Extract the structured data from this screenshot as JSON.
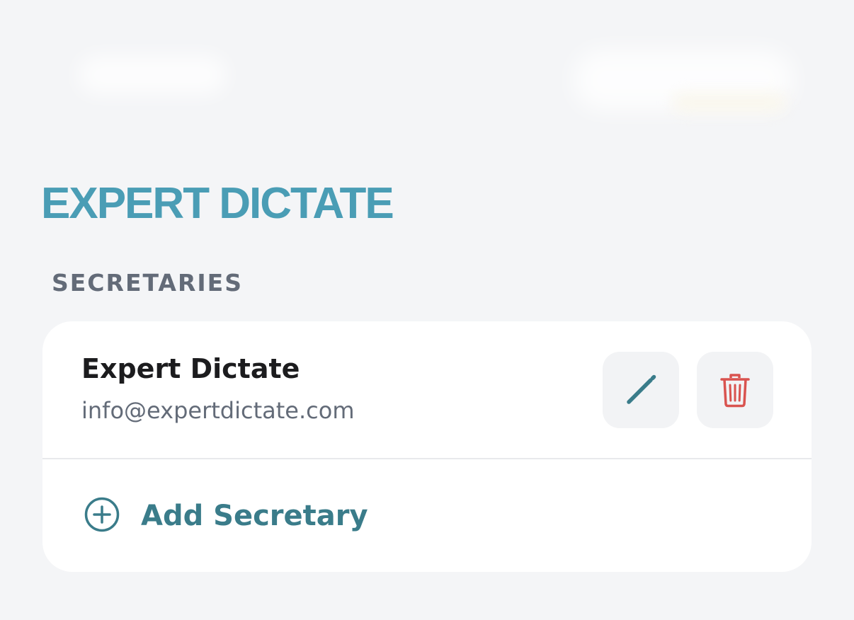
{
  "brand": {
    "logo_text": "EXPERT DICTATE",
    "color": "#4a9db5"
  },
  "section": {
    "header": "SECRETARIES"
  },
  "secretaries": [
    {
      "name": "Expert Dictate",
      "email": "info@expertdictate.com",
      "actions": {
        "edit_icon": "pencil-icon",
        "delete_icon": "trash-icon"
      }
    }
  ],
  "add_action": {
    "label": "Add Secretary",
    "icon": "plus-circle-icon"
  },
  "colors": {
    "background": "#f4f5f7",
    "card": "#ffffff",
    "accent": "#3a7c8a",
    "delete": "#d9534f",
    "muted_text": "#636b78"
  }
}
